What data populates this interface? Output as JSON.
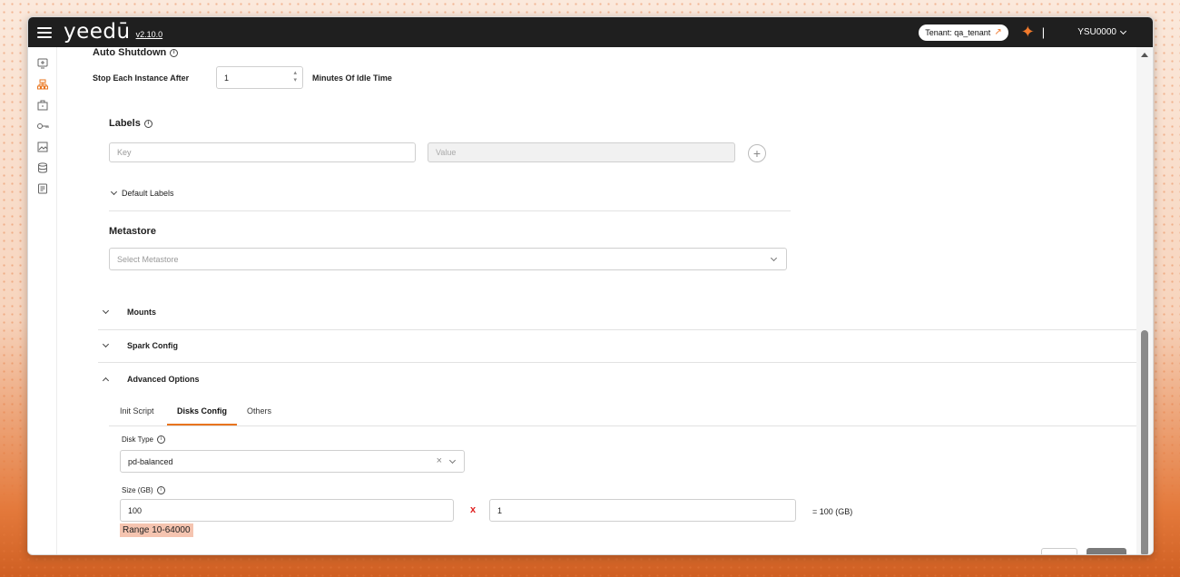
{
  "app": {
    "logo": "yeedū",
    "version": "v2.10.0",
    "tenant_label": "Tenant: qa_tenant",
    "user": "YSU0000"
  },
  "sidebar": {
    "items": [
      {
        "name": "workspace",
        "icon": "monitor-plus-icon"
      },
      {
        "name": "clusters",
        "icon": "cluster-icon",
        "active": true
      },
      {
        "name": "jobs",
        "icon": "briefcase-icon"
      },
      {
        "name": "keys",
        "icon": "key-icon"
      },
      {
        "name": "dashboard",
        "icon": "image-icon"
      },
      {
        "name": "database",
        "icon": "database-icon"
      },
      {
        "name": "notebooks",
        "icon": "document-icon"
      }
    ]
  },
  "auto_shutdown": {
    "title": "Auto Shutdown",
    "prefix": "Stop Each Instance After",
    "value": "1",
    "suffix": "Minutes Of Idle Time"
  },
  "labels": {
    "title": "Labels",
    "key_placeholder": "Key",
    "value_placeholder": "Value",
    "default_labels": "Default Labels"
  },
  "metastore": {
    "title": "Metastore",
    "placeholder": "Select Metastore"
  },
  "sections": {
    "mounts": "Mounts",
    "spark_config": "Spark Config",
    "advanced_options": "Advanced Options"
  },
  "tabs": [
    "Init Script",
    "Disks Config",
    "Others"
  ],
  "active_tab": "Disks Config",
  "disks": {
    "disk_type_label": "Disk Type",
    "disk_type_value": "pd-balanced",
    "size_label": "Size (GB)",
    "size_value": "100",
    "multiplier": "x",
    "count_value": "1",
    "result": "= 100 (GB)",
    "range": "Range 10-64000"
  },
  "colors": {
    "accent": "#e8741e",
    "topbar": "#1f1f1f",
    "range_bg": "#f5c4b0"
  }
}
